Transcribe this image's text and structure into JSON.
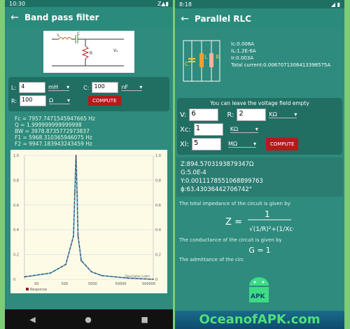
{
  "left": {
    "status_time": "10:30",
    "status_right": "Z▲▮",
    "title": "Band pass filter",
    "circuit_labels": {
      "l": "L",
      "c": "C",
      "r": "R",
      "vout": "Vₒ"
    },
    "inputs": {
      "l_label": "L:",
      "l_value": "4",
      "l_unit": "mH",
      "c_label": "C:",
      "c_value": "100",
      "c_unit": "nF",
      "r_label": "R:",
      "r_value": "100",
      "r_unit": "Ω"
    },
    "compute_label": "COMPUTE",
    "results": [
      "Fc = 7957.7471545947665 Hz",
      "Q = 1.999999999999998",
      "BW = 3978.8735772973837",
      "F1 = 5968.310365946075 Hz",
      "F2 = 9947.183943243459 Hz"
    ],
    "chart_data": {
      "type": "line",
      "title": "",
      "x": [
        5,
        50,
        200,
        400,
        450,
        500,
        550,
        600,
        800,
        2000,
        5000,
        50000,
        500000
      ],
      "series": [
        {
          "name": "Response",
          "values": [
            0.02,
            0.05,
            0.12,
            0.35,
            0.7,
            1.0,
            0.7,
            0.35,
            0.15,
            0.06,
            0.03,
            0.01,
            0.0
          ]
        }
      ],
      "ylim": [
        0,
        1.0
      ],
      "y_ticks": [
        "0",
        "0.2",
        "0.4",
        "0.6",
        "0.8",
        "1.0"
      ],
      "x_ticks": [
        "50",
        "500",
        "5000",
        "50000",
        "500000"
      ],
      "legend": "Response",
      "description": "Description Label"
    },
    "nav": [
      "◀",
      "●",
      "■"
    ]
  },
  "right": {
    "status_time": "8:18",
    "status_right": "◢ ▮",
    "title": "Parallel RLC",
    "circuit_labels": {
      "c": "C",
      "l": "L",
      "r": "R"
    },
    "currents": [
      "Ic:0.006A",
      "IL:1.2E-6A",
      "Ir:0.003A",
      "Total current:0.006707130641339857​5A"
    ],
    "hint": "You can leave the voltage field empty",
    "inputs": {
      "v_label": "V:",
      "v_value": "6",
      "r_label": "R:",
      "r_value": "2",
      "r_unit": "KΩ",
      "xc_label": "Xc:",
      "xc_value": "1",
      "xc_unit": "KΩ",
      "xl_label": "Xl:",
      "xl_value": "5",
      "xl_unit": "MΩ"
    },
    "compute_label": "COMPUTE",
    "results": [
      "Z:894.5703193879347Ω",
      "G:5.0E-4",
      "Y:0.0011178551068899763",
      "ϕ:63.43036442706742°"
    ],
    "explain1": "The total impedance of the circuit is given by",
    "explain2": "The conductance of the circuit is given by",
    "explain3": "The admittance of the circ",
    "formula_z": "Z =",
    "formula_g": "G =",
    "watermark": "OceanofAPK.com"
  }
}
